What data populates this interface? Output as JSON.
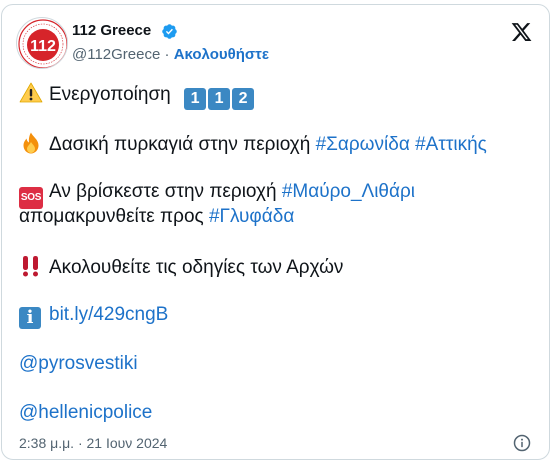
{
  "account": {
    "display_name": "112 Greece",
    "handle": "@112Greece",
    "separator": "·",
    "follow_label": "Ακολουθήστε",
    "avatar_text": "112",
    "verified": true
  },
  "tweet": {
    "line1": {
      "emoji": "warning-icon",
      "text": "Ενεργοποίηση",
      "keycaps": [
        "1",
        "1",
        "2"
      ]
    },
    "line2": {
      "emoji": "fire-icon",
      "text": "Δασική πυρκαγιά στην περιοχή",
      "hashtags": [
        "#Σαρωνίδα",
        "#Αττικής"
      ]
    },
    "line3": {
      "badge": "SOS",
      "text": "Αν βρίσκεστε στην περιοχή",
      "hashtag": "#Μαύρο_Λιθάρι"
    },
    "line4": {
      "text": "απομακρυνθείτε προς",
      "hashtag": "#Γλυφάδα"
    },
    "line5": {
      "emoji": "double-exclamation-icon",
      "text": "Ακολουθείτε τις οδηγίες των Αρχών"
    },
    "line6": {
      "badge": "i",
      "link": "bit.ly/429cngB"
    },
    "mention1": "@pyrosvestiki",
    "mention2": "@hellenicpolice"
  },
  "timestamp": "2:38 μ.μ. · 21 Ιουν 2024",
  "colors": {
    "link": "#1d72c9",
    "text": "#0f1419",
    "muted": "#536471",
    "verified": "#1d9bf0",
    "avatar_red": "#d6242a"
  },
  "icons": [
    "x-logo-icon",
    "verified-badge-icon",
    "info-circle-icon"
  ]
}
